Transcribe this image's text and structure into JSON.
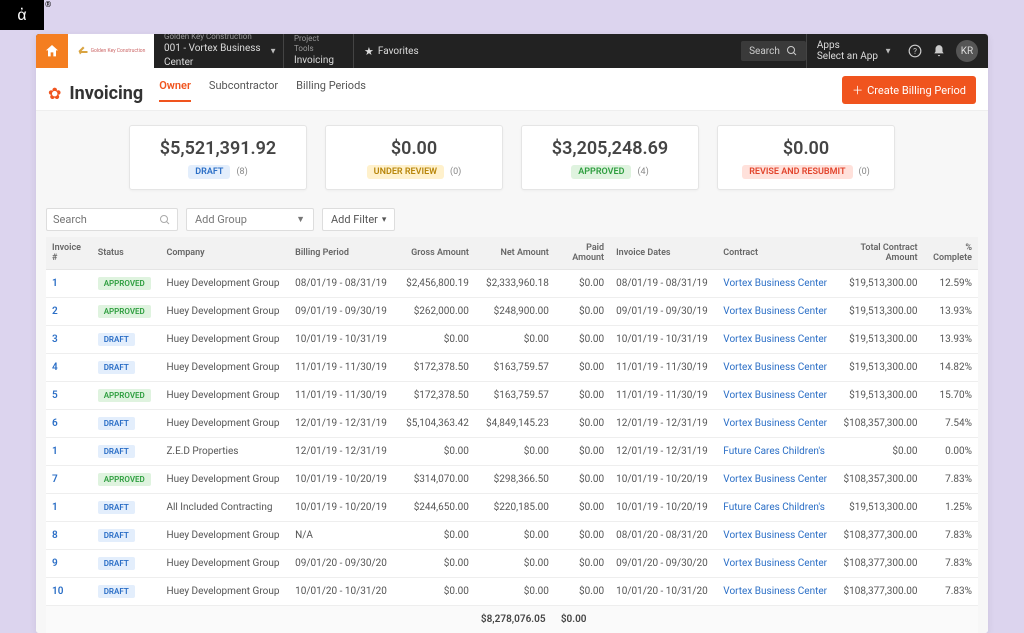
{
  "topbar": {
    "project_label": "Golden Key Construction",
    "project_value": "001 - Vortex Business Center",
    "tools_label": "Project Tools",
    "tools_value": "Invoicing",
    "favorites": "Favorites",
    "search_placeholder": "Search",
    "apps_label": "Apps",
    "apps_value": "Select an App",
    "avatar": "KR"
  },
  "header": {
    "title": "Invoicing",
    "tabs": [
      "Owner",
      "Subcontractor",
      "Billing Periods"
    ],
    "active_tab": 0,
    "create_button": "Create Billing Period"
  },
  "stats": [
    {
      "amount": "$5,521,391.92",
      "pill": "DRAFT",
      "pill_class": "draft",
      "count": "(8)"
    },
    {
      "amount": "$0.00",
      "pill": "UNDER REVIEW",
      "pill_class": "review",
      "count": "(0)"
    },
    {
      "amount": "$3,205,248.69",
      "pill": "APPROVED",
      "pill_class": "approved",
      "count": "(4)"
    },
    {
      "amount": "$0.00",
      "pill": "REVISE AND RESUBMIT",
      "pill_class": "revise",
      "count": "(0)"
    }
  ],
  "filters": {
    "search_placeholder": "Search",
    "group_placeholder": "Add Group",
    "addfilter": "Add Filter"
  },
  "columns": [
    "Invoice #",
    "Status",
    "Company",
    "Billing Period",
    "Gross Amount",
    "Net Amount",
    "Paid Amount",
    "Invoice Dates",
    "Contract",
    "Total Contract Amount",
    "% Complete"
  ],
  "rows": [
    {
      "n": "1",
      "status": "APPROVED",
      "company": "Huey Development Group",
      "bp": "08/01/19 - 08/31/19",
      "gross": "$2,456,800.19",
      "net": "$2,333,960.18",
      "paid": "$0.00",
      "dates": "08/01/19 - 08/31/19",
      "contract": "Vortex Business Center",
      "tca": "$19,513,300.00",
      "pct": "12.59%"
    },
    {
      "n": "2",
      "status": "APPROVED",
      "company": "Huey Development Group",
      "bp": "09/01/19 - 09/30/19",
      "gross": "$262,000.00",
      "net": "$248,900.00",
      "paid": "$0.00",
      "dates": "09/01/19 - 09/30/19",
      "contract": "Vortex Business Center",
      "tca": "$19,513,300.00",
      "pct": "13.93%"
    },
    {
      "n": "3",
      "status": "DRAFT",
      "company": "Huey Development Group",
      "bp": "10/01/19 - 10/31/19",
      "gross": "$0.00",
      "net": "$0.00",
      "paid": "$0.00",
      "dates": "10/01/19 - 10/31/19",
      "contract": "Vortex Business Center",
      "tca": "$19,513,300.00",
      "pct": "13.93%"
    },
    {
      "n": "4",
      "status": "DRAFT",
      "company": "Huey Development Group",
      "bp": "11/01/19 - 11/30/19",
      "gross": "$172,378.50",
      "net": "$163,759.57",
      "paid": "$0.00",
      "dates": "11/01/19 - 11/30/19",
      "contract": "Vortex Business Center",
      "tca": "$19,513,300.00",
      "pct": "14.82%"
    },
    {
      "n": "5",
      "status": "APPROVED",
      "company": "Huey Development Group",
      "bp": "11/01/19 - 11/30/19",
      "gross": "$172,378.50",
      "net": "$163,759.57",
      "paid": "$0.00",
      "dates": "11/01/19 - 11/30/19",
      "contract": "Vortex Business Center",
      "tca": "$19,513,300.00",
      "pct": "15.70%"
    },
    {
      "n": "6",
      "status": "DRAFT",
      "company": "Huey Development Group",
      "bp": "12/01/19 - 12/31/19",
      "gross": "$5,104,363.42",
      "net": "$4,849,145.23",
      "paid": "$0.00",
      "dates": "12/01/19 - 12/31/19",
      "contract": "Vortex Business Center",
      "tca": "$108,357,300.00",
      "pct": "7.54%"
    },
    {
      "n": "1",
      "status": "DRAFT",
      "company": "Z.E.D Properties",
      "bp": "12/01/19 - 12/31/19",
      "gross": "$0.00",
      "net": "$0.00",
      "paid": "$0.00",
      "dates": "12/01/19 - 12/31/19",
      "contract": "Future Cares Children's",
      "tca": "$0.00",
      "pct": "0.00%"
    },
    {
      "n": "7",
      "status": "APPROVED",
      "company": "Huey Development Group",
      "bp": "10/01/19 - 10/20/19",
      "gross": "$314,070.00",
      "net": "$298,366.50",
      "paid": "$0.00",
      "dates": "10/01/19 - 10/20/19",
      "contract": "Vortex Business Center",
      "tca": "$108,357,300.00",
      "pct": "7.83%"
    },
    {
      "n": "1",
      "status": "DRAFT",
      "company": "All Included Contracting",
      "bp": "10/01/19 - 10/20/19",
      "gross": "$244,650.00",
      "net": "$220,185.00",
      "paid": "$0.00",
      "dates": "10/01/19 - 10/20/19",
      "contract": "Future Cares Children's",
      "tca": "$19,513,300.00",
      "pct": "1.25%"
    },
    {
      "n": "8",
      "status": "DRAFT",
      "company": "Huey Development Group",
      "bp": "N/A",
      "gross": "$0.00",
      "net": "$0.00",
      "paid": "$0.00",
      "dates": "08/01/20 - 08/31/20",
      "contract": "Vortex Business Center",
      "tca": "$108,377,300.00",
      "pct": "7.83%"
    },
    {
      "n": "9",
      "status": "DRAFT",
      "company": "Huey Development Group",
      "bp": "09/01/20 - 09/30/20",
      "gross": "$0.00",
      "net": "$0.00",
      "paid": "$0.00",
      "dates": "09/01/20 - 09/30/20",
      "contract": "Vortex Business Center",
      "tca": "$108,377,300.00",
      "pct": "7.83%"
    },
    {
      "n": "10",
      "status": "DRAFT",
      "company": "Huey Development Group",
      "bp": "10/01/20 - 10/31/20",
      "gross": "$0.00",
      "net": "$0.00",
      "paid": "$0.00",
      "dates": "10/01/20 - 10/31/20",
      "contract": "Vortex Business Center",
      "tca": "$108,377,300.00",
      "pct": "7.83%"
    }
  ],
  "totals": {
    "net": "$8,278,076.05",
    "paid": "$0.00"
  }
}
